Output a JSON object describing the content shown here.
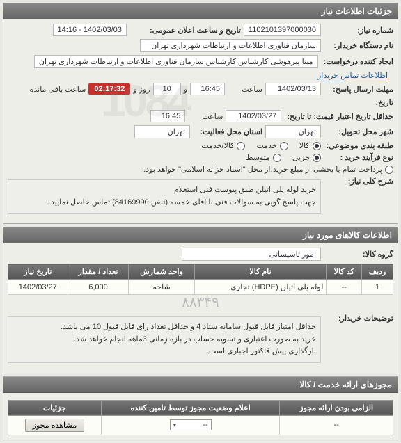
{
  "panel1": {
    "title": "جزئیات اطلاعات نیاز",
    "need_no_label": "شماره نیاز:",
    "need_no": "1102101397000030",
    "ann_label": "تاریخ و ساعت اعلان عمومی:",
    "ann_value": "1402/03/03 - 14:16",
    "buyer_label": "نام دستگاه خریدار:",
    "buyer": "سازمان فناوری اطلاعات و ارتباطات شهرداری تهران",
    "creator_label": "ایجاد کننده درخواست:",
    "creator": "مینا پیرهوشی کارشناس کارشناس سازمان فناوری اطلاعات و ارتباطات شهرداری تهران",
    "contact_link": "اطلاعات تماس خریدار",
    "deadline_label": "مهلت ارسال پاسخ:",
    "deadline_date": "1402/03/13",
    "time_label": "ساعت",
    "deadline_time": "16:45",
    "and_label": "و",
    "days": "10",
    "days_label": "روز و",
    "timer": "02:17:32",
    "remain_label": "ساعت باقی مانده",
    "hist_label": "تاریخ:",
    "valid_label": "حداقل تاریخ اعتبار قیمت: تا تاریخ:",
    "valid_date": "1402/03/27",
    "valid_time": "16:45",
    "del_loc_label": "شهر محل تحویل:",
    "del_loc": "تهران",
    "act_loc_label": "استان محل فعالیت:",
    "act_loc": "تهران",
    "cat_label": "طبقه بندی موضوعی:",
    "cat_goods": "کالا",
    "cat_service": "خدمت",
    "cat_both": "کالا/خدمت",
    "ptype_label": "نوع فرآیند خرید :",
    "ptype_partial": "جزیی",
    "ptype_medium": "متوسط",
    "ptype_note": "پرداخت تمام یا بخشی از مبلغ خرید،از محل \"اسناد خزانه اسلامی\" خواهد بود.",
    "summary_label": "شرح کلی نیاز:",
    "summary": "خرید لوله پلی اتیلن طبق پیوست فنی استعلام\nجهت پاسخ گویی به سوالات فنی با آقای خمسه (تلفن 84169990) تماس حاصل نمایید.",
    "watermark": "1084"
  },
  "panel2": {
    "title": "اطلاعات کالاهای مورد نیاز",
    "group_label": "گروه کالا:",
    "group": "امور تاسیساتی",
    "cols": {
      "row": "ردیف",
      "code": "کد کالا",
      "name": "نام کالا",
      "unit": "واحد شمارش",
      "qty": "تعداد / مقدار",
      "date": "تاریخ نیاز"
    },
    "rows": [
      {
        "row": "1",
        "code": "--",
        "name": "لوله پلی اتیلن (HDPE) تجاری",
        "unit": "شاخه",
        "qty": "6,000",
        "date": "1402/03/27"
      }
    ],
    "notes_label": "توضیحات خریدار:",
    "notes": "حداقل امتیاز قابل قبول سامانه ستاد 4 و حداقل تعداد رای قابل قبول 10 می باشد.\nخرید به صورت اعتباری و تسویه حساب در بازه زمانی 3ماهه انجام خواهد شد.\nبارگذاری پیش فاکتور اجباری است.",
    "phone_strip": "۸۸۳۴۹"
  },
  "panel3": {
    "title": "مجوزهای ارائه خدمت / کالا",
    "cols": {
      "mandatory": "الزامی بودن ارائه مجوز",
      "status": "اعلام وضعیت مجوز توسط تامین کننده",
      "details": "جزئیات"
    },
    "row": {
      "mandatory": "--",
      "status": "--",
      "view": "مشاهده مجوز"
    }
  }
}
